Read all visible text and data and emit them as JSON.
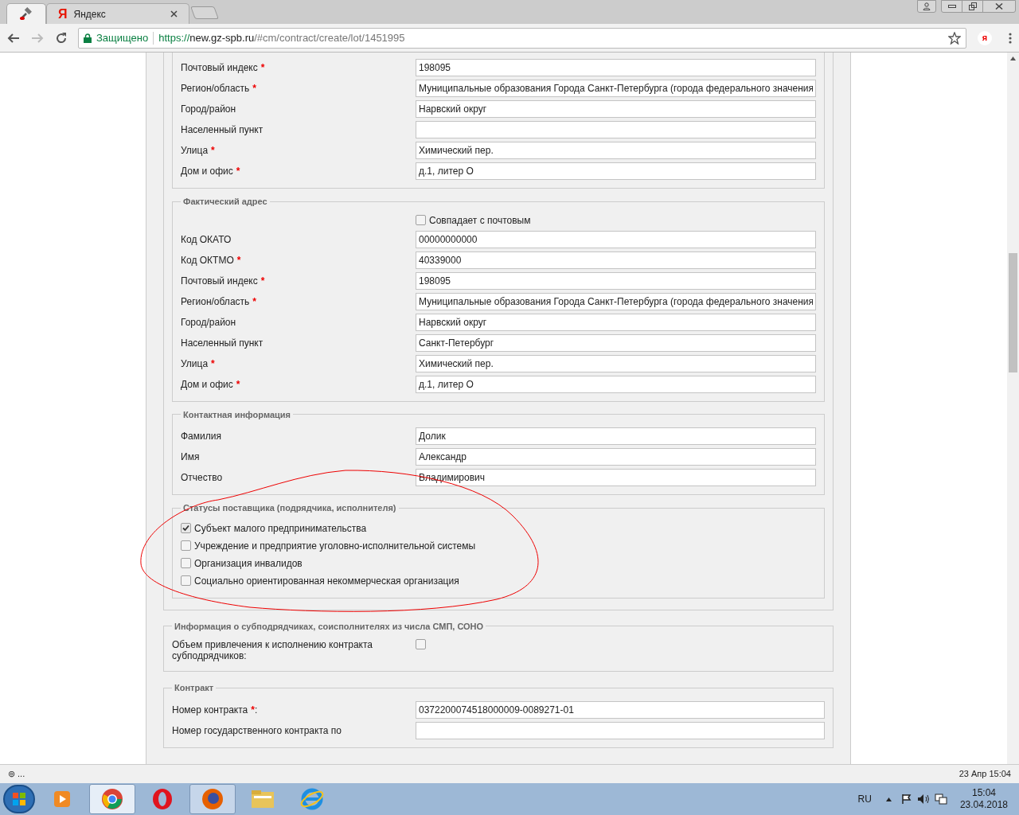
{
  "browser": {
    "tabs": [
      {
        "kind": "app",
        "selected": true
      },
      {
        "kind": "yandex",
        "icon_letter": "Я",
        "title": "Яндекс",
        "selected": false
      }
    ],
    "secure_label": "Защищено",
    "url_scheme": "https://",
    "url_host": "new.gz-spb.ru",
    "url_path": "/#cm/contract/create/lot/1451995",
    "extension_label": "я"
  },
  "postal_address": {
    "fields": [
      {
        "label": "Почтовый индекс",
        "required": true,
        "value": "198095"
      },
      {
        "label": "Регион/область",
        "required": true,
        "value": "Муниципальные образования Города Санкт-Петербурга (города федерального значения"
      },
      {
        "label": "Город/район",
        "required": false,
        "value": "Нарвский округ"
      },
      {
        "label": "Населенный пункт",
        "required": false
      },
      {
        "label": "Улица",
        "required": true,
        "value": "Химический пер."
      },
      {
        "label": "Дом и офис",
        "required": true,
        "value": "д.1, литер О"
      }
    ]
  },
  "actual_address": {
    "legend": "Фактический адрес",
    "same_as_postal": {
      "label": "Совпадает с почтовым",
      "checked": false
    },
    "fields": [
      {
        "label": "Код ОКАТО",
        "required": false,
        "value": "00000000000"
      },
      {
        "label": "Код ОКТМО",
        "required": true,
        "value": "40339000"
      },
      {
        "label": "Почтовый индекс",
        "required": true,
        "value": "198095"
      },
      {
        "label": "Регион/область",
        "required": true,
        "value": "Муниципальные образования Города Санкт-Петербурга (города федерального значения"
      },
      {
        "label": "Город/район",
        "required": false,
        "value": "Нарвский округ"
      },
      {
        "label": "Населенный пункт",
        "required": false,
        "value": "Санкт-Петербург"
      },
      {
        "label": "Улица",
        "required": true,
        "value": "Химический пер."
      },
      {
        "label": "Дом и офис",
        "required": true,
        "value": "д.1, литер О"
      }
    ]
  },
  "contact": {
    "legend": "Контактная информация",
    "fields": [
      {
        "label": "Фамилия",
        "required": false,
        "value": "Долик"
      },
      {
        "label": "Имя",
        "required": false,
        "value": "Александр"
      },
      {
        "label": "Отчество",
        "required": false,
        "value": "Владимирович"
      }
    ]
  },
  "supplier_statuses": {
    "legend": "Статусы поставщика (подрядчика, исполнителя)",
    "options": [
      {
        "label": "Субъект малого предпринимательства",
        "checked": true
      },
      {
        "label": "Учреждение и предприятие уголовно-исполнительной системы",
        "checked": false
      },
      {
        "label": "Организация инвалидов",
        "checked": false
      },
      {
        "label": "Социально ориентированная некоммерческая организация",
        "checked": false
      }
    ]
  },
  "subcontractors": {
    "legend": "Информация о субподрядчиках, соисполнителях из числа СМП, СОНО",
    "field": {
      "label": "Объем привлечения к исполнению контракта субподрядчиков:",
      "checked": false
    }
  },
  "contract": {
    "legend": "Контракт",
    "fields": [
      {
        "label": "Номер контракта",
        "required": true,
        "suffix": ":",
        "value": "0372200074518000009-0089271-01"
      },
      {
        "label": "Номер государственного контракта по",
        "required": false
      }
    ]
  },
  "required_mark": "*",
  "status_bar": {
    "left": "⊚ ...",
    "right": "23 Апр 15:04"
  },
  "taskbar": {
    "language": "RU",
    "time": "15:04",
    "date": "23.04.2018"
  }
}
